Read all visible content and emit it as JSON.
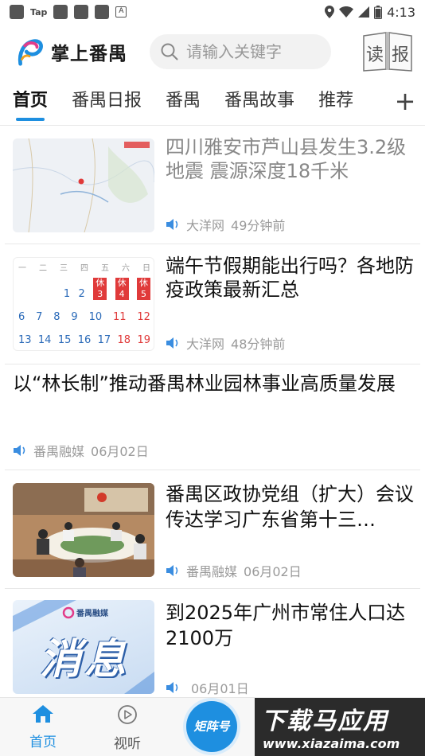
{
  "status_bar": {
    "tap_label": "Tap",
    "time": "4:13"
  },
  "header": {
    "app_name": "掌上番禺",
    "search_placeholder": "请输入关键字",
    "paper_button_left": "读",
    "paper_button_right": "报"
  },
  "tabs": [
    {
      "label": "首页",
      "active": true
    },
    {
      "label": "番禺日报",
      "active": false
    },
    {
      "label": "番禺",
      "active": false
    },
    {
      "label": "番禺故事",
      "active": false
    },
    {
      "label": "推荐",
      "active": false
    }
  ],
  "tab_add": "+",
  "news": [
    {
      "title": "四川雅安市芦山县发生3.2级地震 震源深度18千米",
      "source": "大洋网",
      "time": "49分钟前",
      "read": true,
      "thumb": "map"
    },
    {
      "title": "端午节假期能出行吗？各地防疫政策最新汇总",
      "source": "大洋网",
      "time": "48分钟前",
      "read": false,
      "thumb": "calendar"
    },
    {
      "title": "以“林长制”推动番禺林业园林事业高质量发展",
      "source": "番禺融媒",
      "time": "06月02日",
      "read": false,
      "thumb": "none"
    },
    {
      "title": "番禺区政协党组（扩大）会议传达学习广东省第十三…",
      "source": "番禺融媒",
      "time": "06月02日",
      "read": false,
      "thumb": "meeting"
    },
    {
      "title": "到2025年广州市常住人口达2100万",
      "source": "",
      "time": "06月01日",
      "read": false,
      "thumb": "news"
    }
  ],
  "thumb_text": {
    "calendar_weekdays": [
      "一",
      "二",
      "三",
      "四",
      "五",
      "六",
      "日"
    ],
    "calendar_row1": [
      "1",
      "2",
      "3",
      "4",
      "5"
    ],
    "calendar_row2": [
      "6",
      "7",
      "8",
      "9",
      "10",
      "11",
      "12"
    ],
    "calendar_row3": [
      "13",
      "14",
      "15",
      "16",
      "17",
      "18",
      "19"
    ],
    "holiday_mark": "休",
    "news_brand": "番禺融媒",
    "news_big_text": "消息"
  },
  "bottom_nav": {
    "home_label": "首页",
    "listen_label": "视听",
    "matrix_label": "矩阵号"
  },
  "watermark": {
    "top": "下载马应用",
    "bottom": "www.xiazaima.com"
  },
  "colors": {
    "accent": "#1e8fe0",
    "holiday_red": "#e03a3a"
  }
}
